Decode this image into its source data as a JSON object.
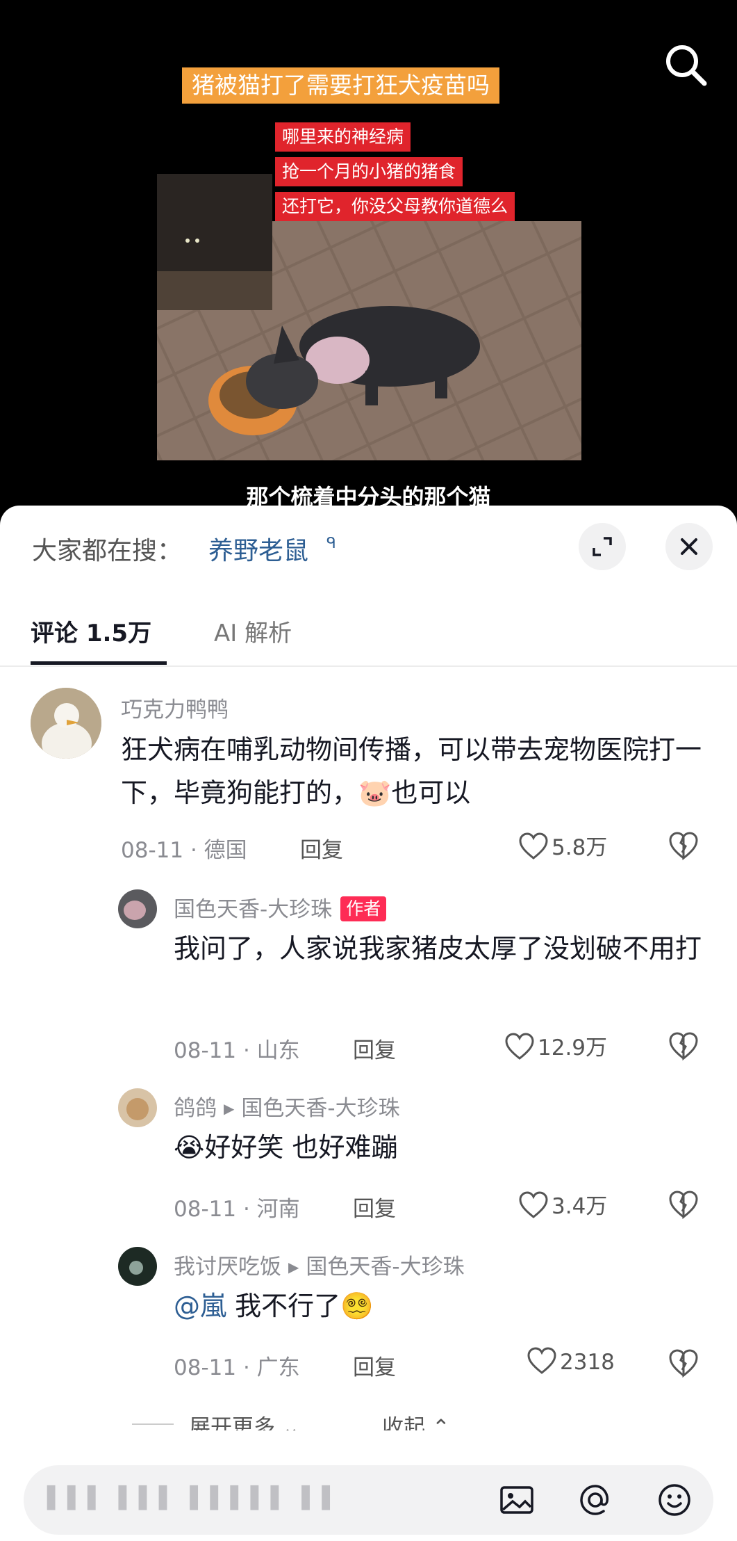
{
  "video": {
    "title_banner": "猪被猫打了需要打狂犬疫苗吗",
    "captions": [
      "哪里来的神经病",
      "抢一个月的小猪的猪食",
      "还打它，你没父母教你道德么"
    ],
    "subtitle": "那个梳着中分头的那个猫"
  },
  "search": {
    "label": "大家都在搜：",
    "term": "养野老鼠",
    "mini_icon": "ᑫ"
  },
  "tabs": [
    {
      "label": "评论 1.5万"
    },
    {
      "label": "AI 解析"
    }
  ],
  "comments": [
    {
      "user": "巧克力鸭鸭",
      "text": "狂犬病在哺乳动物间传播，可以带去宠物医院打一下，毕竟狗能打的，",
      "text_tail": "也可以",
      "date": "08-11",
      "location": "德国",
      "reply": "回复",
      "likes": "5.8万"
    },
    {
      "user": "国色天香-大珍珠",
      "badge": "作者",
      "text": "我问了，人家说我家猪皮太厚了没划破不用打",
      "date": "08-11",
      "location": "山东",
      "reply": "回复",
      "likes": "12.9万"
    },
    {
      "user": "鸽鸽",
      "reply_to": "国色天香-大珍珠",
      "text": "好好笑 也好难蹦",
      "date": "08-11",
      "location": "河南",
      "reply": "回复",
      "likes": "3.4万"
    },
    {
      "user": "我讨厌吃饭",
      "reply_to": "国色天香-大珍珠",
      "mention": "@嵐",
      "text": " 我不行了",
      "date": "08-11",
      "location": "广东",
      "reply": "回复",
      "likes": "2318"
    }
  ],
  "more": {
    "expand": "展开更多",
    "collapse": "收起"
  },
  "input": {
    "placeholder": "▌▌▌ ▌▌▌ ▌▌▌▌▌ ▌▌"
  },
  "icons": {
    "search": "search-icon",
    "expand": "expand-icon",
    "close": "close-icon",
    "like": "heart-icon",
    "dislike": "broken-heart-icon",
    "image": "image-icon",
    "at": "at-icon",
    "emoji": "emoji-icon"
  }
}
